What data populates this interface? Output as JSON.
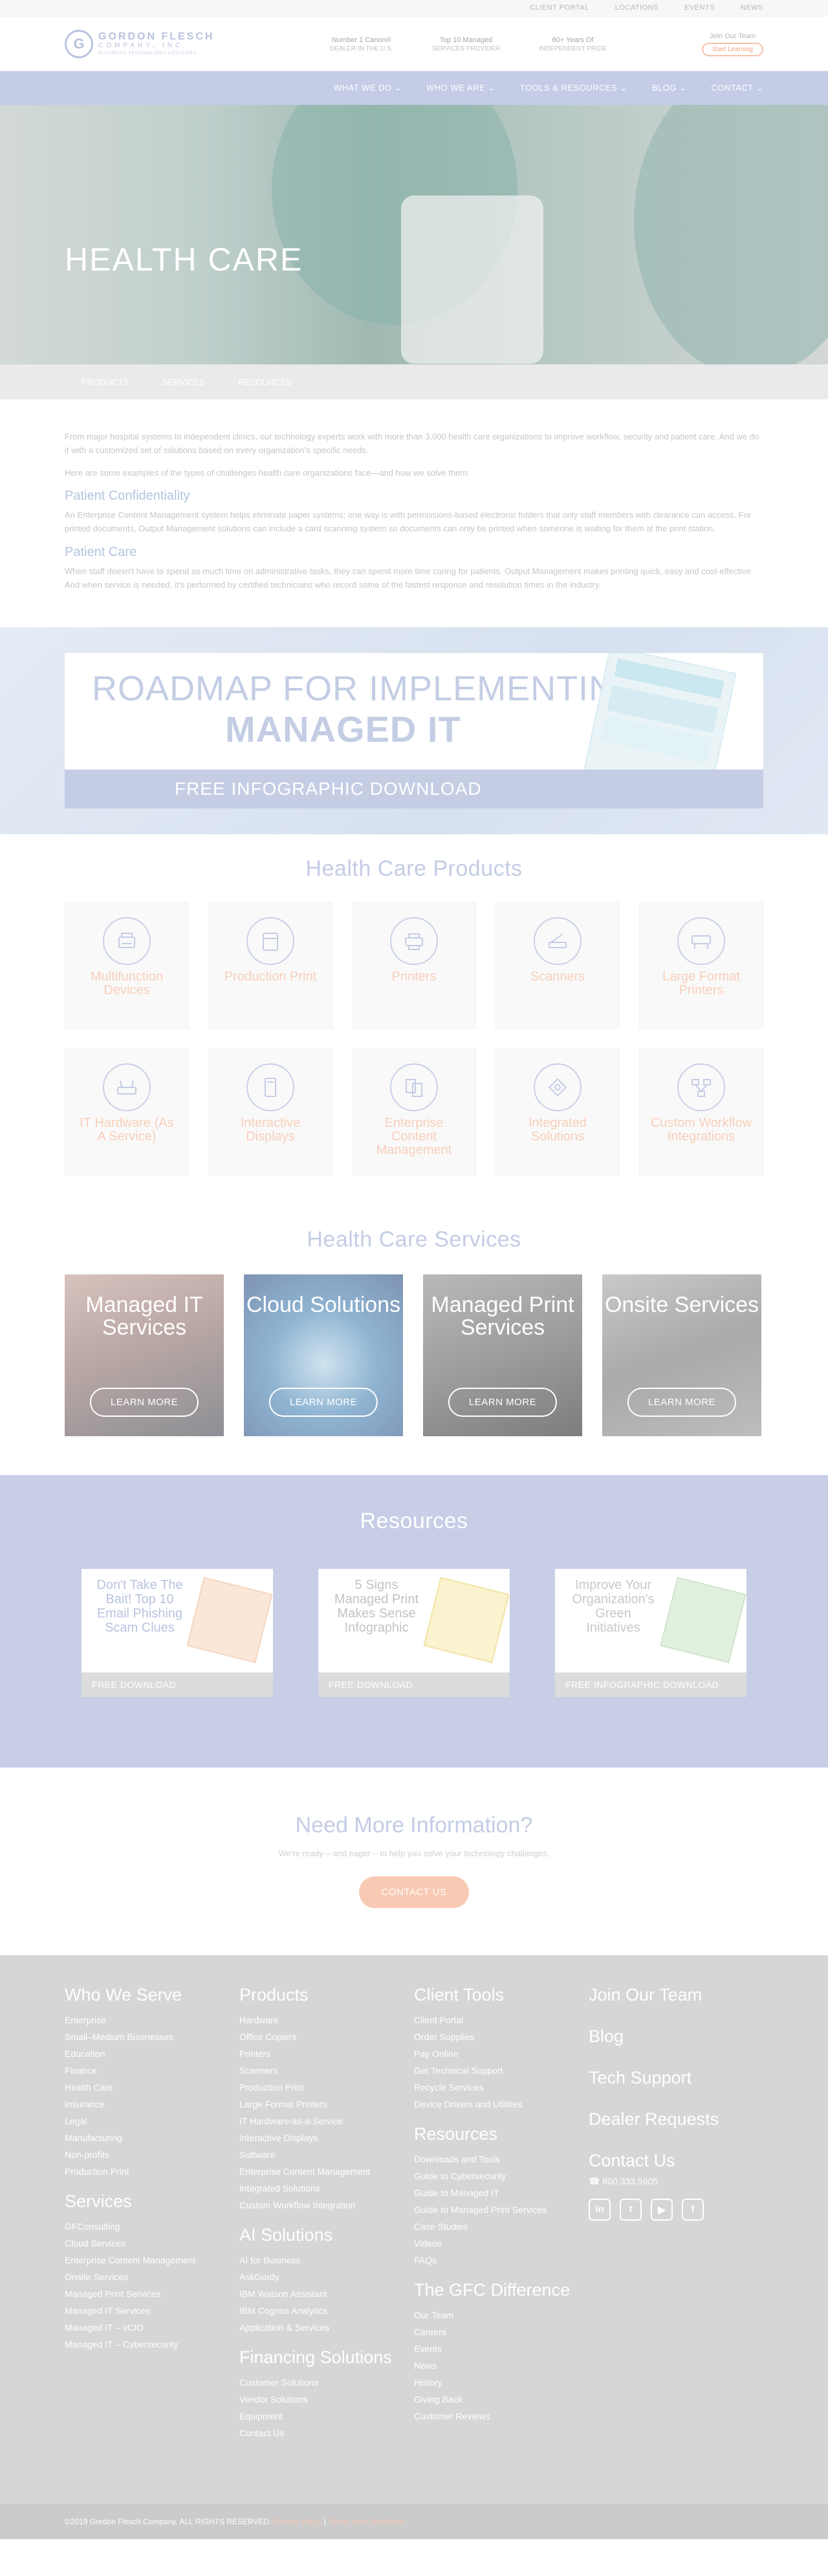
{
  "utility": [
    "CLIENT PORTAL",
    "LOCATIONS",
    "EVENTS",
    "NEWS"
  ],
  "brand": {
    "name": "GORDON FLESCH",
    "sub": "COMPANY, INC.",
    "tag": "BUSINESS TECHNOLOGY ADVISORS",
    "accent": "#c4cce6",
    "orange": "#f8c9b3"
  },
  "stats": [
    {
      "title": "Number 1 Canon®",
      "sub": "DEALER IN THE U.S."
    },
    {
      "title": "Top 10 Managed",
      "sub": "SERVICES PROVIDER"
    },
    {
      "title": "60+ Years Of",
      "sub": "INDEPENDENT PRIDE"
    }
  ],
  "join": {
    "title": "Join Our Team",
    "button": "Start Learning"
  },
  "nav": [
    "WHAT WE DO",
    "WHO WE ARE",
    "TOOLS & RESOURCES",
    "BLOG",
    "CONTACT"
  ],
  "hero": {
    "title": "HEALTH CARE"
  },
  "subnav": [
    "PRODUCTS",
    "SERVICES",
    "RESOURCES"
  ],
  "intro": {
    "p1": "From major hospital systems to independent clinics, our technology experts work with more than 3,000 health care organizations to improve workflow, security and patient care. And we do it with a customized set of solutions based on every organization's specific needs.",
    "p2": "Here are some examples of the types of challenges health care organizations face—and how we solve them:",
    "h1": "Patient Confidentiality",
    "p3": "An Enterprise Content Management system helps eliminate paper systems; one way is with permissions-based electronic folders that only staff members with clearance can access. For printed documents, Output Management solutions can include a card scanning system so documents can only be printed when someone is waiting for them at the print station.",
    "h2": "Patient Care",
    "p4": "When staff doesn't have to spend as much time on administrative tasks, they can spend more time caring for patients. Output Management makes printing quick, easy and cost-effective. And when service is needed, it's performed by certified technicians who record some of the fastest response and resolution times in the industry."
  },
  "banner": {
    "line1": "ROADMAP FOR IMPLEMENTING",
    "line2": "MANAGED IT",
    "cta": "FREE INFOGRAPHIC DOWNLOAD"
  },
  "products": {
    "title": "Health Care Products",
    "items": [
      {
        "label": "Multifunction Devices",
        "icon": "mfp-icon"
      },
      {
        "label": "Production Print",
        "icon": "production-print-icon"
      },
      {
        "label": "Printers",
        "icon": "printer-icon"
      },
      {
        "label": "Scanners",
        "icon": "scanner-icon"
      },
      {
        "label": "Large Format Printers",
        "icon": "large-format-printer-icon"
      },
      {
        "label": "IT Hardware (As A Service)",
        "icon": "router-icon"
      },
      {
        "label": "Interactive Displays",
        "icon": "display-icon"
      },
      {
        "label": "Enterprise Content Management",
        "icon": "documents-icon"
      },
      {
        "label": "Integrated Solutions",
        "icon": "puzzle-icon"
      },
      {
        "label": "Custom Workflow Integrations",
        "icon": "workflow-icon"
      }
    ]
  },
  "services": {
    "title": "Health Care Services",
    "items": [
      {
        "name": "Managed IT Services",
        "button": "LEARN MORE"
      },
      {
        "name": "Cloud Solutions",
        "button": "LEARN MORE"
      },
      {
        "name": "Managed Print Services",
        "button": "LEARN MORE"
      },
      {
        "name": "Onsite Services",
        "button": "LEARN MORE"
      }
    ]
  },
  "resources": {
    "title": "Resources",
    "items": [
      {
        "title": "Don't Take The Bait! Top 10 Email Phishing Scam Clues",
        "cta": "FREE DOWNLOAD"
      },
      {
        "title": "5 Signs Managed Print Makes Sense Infographic",
        "cta": "FREE DOWNLOAD"
      },
      {
        "title": "Improve Your Organization's Green Initiatives",
        "cta": "FREE INFOGRAPHIC DOWNLOAD"
      }
    ]
  },
  "need": {
    "title": "Need More Information?",
    "text": "We're ready – and eager – to help you solve your technology challenges.",
    "button": "CONTACT US"
  },
  "footer": {
    "who": {
      "title": "Who We Serve",
      "items": [
        "Enterprise",
        "Small–Medium Businesses",
        "Education",
        "Finance",
        "Health Care",
        "Insurance",
        "Legal",
        "Manufacturing",
        "Non-profits",
        "Production Print"
      ]
    },
    "services": {
      "title": "Services",
      "items": [
        "GFConsulting",
        "Cloud Services",
        "Enterprise Content Management",
        "Onsite Services",
        "Managed Print Services",
        "Managed IT Services",
        "Managed IT – vCIO",
        "Managed IT – Cybersecurity"
      ]
    },
    "products": {
      "title": "Products",
      "items": [
        "Hardware",
        "Office Copiers",
        "Printers",
        "Scanners",
        "Production Print",
        "Large Format Printers",
        "IT Hardware-as-a-Service",
        "Interactive Displays",
        "Software",
        "Enterprise Content Management",
        "Integrated Solutions",
        "Custom Workflow Integration"
      ]
    },
    "ai": {
      "title": "AI Solutions",
      "items": [
        "AI for Business",
        "AskGordy",
        "IBM Watson Assistant",
        "IBM Cognos Analytics",
        "Application & Services"
      ]
    },
    "financing": {
      "title": "Financing Solutions",
      "items": [
        "Customer Solutions",
        "Vendor Solutions",
        "Equipment",
        "Contact Us"
      ]
    },
    "client": {
      "title": "Client Tools",
      "items": [
        "Client Portal",
        "Order Supplies",
        "Pay Online",
        "Get Technical Support",
        "Recycle Services",
        "Device Drivers and Utilities"
      ]
    },
    "resources": {
      "title": "Resources",
      "items": [
        "Downloads and Tools",
        "Guide to Cybersecurity",
        "Guide to Managed IT",
        "Guide to Managed Print Services",
        "Case Studies",
        "Videos",
        "FAQs"
      ]
    },
    "gfc": {
      "title": "The GFC Difference",
      "items": [
        "Our Team",
        "Careers",
        "Events",
        "News",
        "History",
        "Giving Back",
        "Customer Reviews"
      ]
    },
    "right": {
      "links": [
        "Join Our Team",
        "Blog",
        "Tech Support",
        "Dealer Requests"
      ],
      "contact": "Contact Us",
      "phone": "800.333.5905",
      "social": [
        "in",
        "t",
        "▶",
        "f"
      ]
    }
  },
  "copyright": {
    "text": "©2019 Gordon Flesch Company. ALL RIGHTS RESERVED.",
    "privacy": "Privacy Policy",
    "sep": " | ",
    "terms": "Terms and Conditions"
  }
}
